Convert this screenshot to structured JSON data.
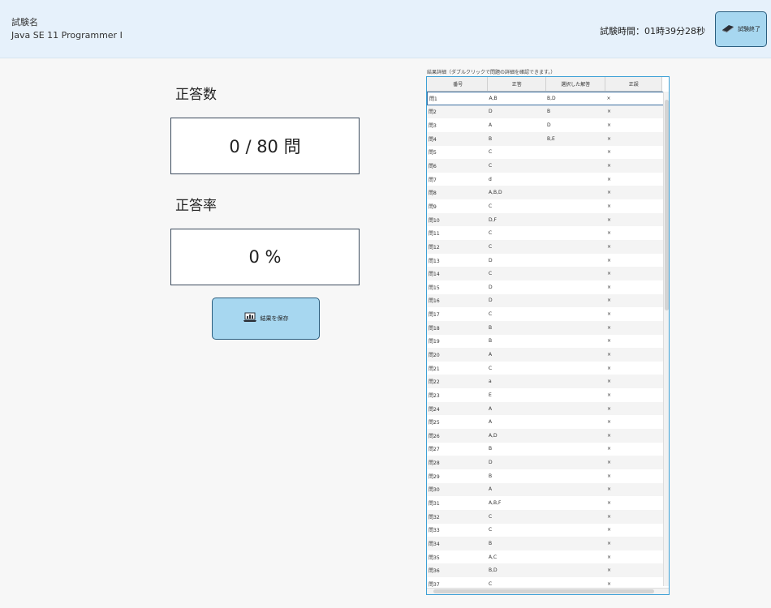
{
  "header": {
    "exam_label": "試験名",
    "exam_name": "Java SE 11 Programmer Ⅰ",
    "timer": "試験時間：01時39分28秒",
    "end_button_label": "試験終了",
    "end_button_icon": "book-icon"
  },
  "score": {
    "correct_title": "正答数",
    "correct_value": "0 / 80 問",
    "rate_title": "正答率",
    "rate_value": "0 %"
  },
  "save_button": {
    "label": "結果を保存",
    "icon": "laptop-chart-icon"
  },
  "results_table": {
    "caption": "結果詳細（ダブルクリックで問題の詳細を確認できます。）",
    "columns": [
      "番号",
      "正答",
      "選択した解答",
      "正誤"
    ],
    "rows": [
      [
        "問1",
        "A,B",
        "B,D",
        "×"
      ],
      [
        "問2",
        "D",
        "B",
        "×"
      ],
      [
        "問3",
        "A",
        "D",
        "×"
      ],
      [
        "問4",
        "B",
        "B,E",
        "×"
      ],
      [
        "問5",
        "C",
        "",
        "×"
      ],
      [
        "問6",
        "C",
        "",
        "×"
      ],
      [
        "問7",
        "d",
        "",
        "×"
      ],
      [
        "問8",
        "A,B,D",
        "",
        "×"
      ],
      [
        "問9",
        "C",
        "",
        "×"
      ],
      [
        "問10",
        "D,F",
        "",
        "×"
      ],
      [
        "問11",
        "C",
        "",
        "×"
      ],
      [
        "問12",
        "C",
        "",
        "×"
      ],
      [
        "問13",
        "D",
        "",
        "×"
      ],
      [
        "問14",
        "C",
        "",
        "×"
      ],
      [
        "問15",
        "D",
        "",
        "×"
      ],
      [
        "問16",
        "D",
        "",
        "×"
      ],
      [
        "問17",
        "C",
        "",
        "×"
      ],
      [
        "問18",
        "B",
        "",
        "×"
      ],
      [
        "問19",
        "B",
        "",
        "×"
      ],
      [
        "問20",
        "A",
        "",
        "×"
      ],
      [
        "問21",
        "C",
        "",
        "×"
      ],
      [
        "問22",
        "a",
        "",
        "×"
      ],
      [
        "問23",
        "E",
        "",
        "×"
      ],
      [
        "問24",
        "A",
        "",
        "×"
      ],
      [
        "問25",
        "A",
        "",
        "×"
      ],
      [
        "問26",
        "A,D",
        "",
        "×"
      ],
      [
        "問27",
        "B",
        "",
        "×"
      ],
      [
        "問28",
        "D",
        "",
        "×"
      ],
      [
        "問29",
        "B",
        "",
        "×"
      ],
      [
        "問30",
        "A",
        "",
        "×"
      ],
      [
        "問31",
        "A,B,F",
        "",
        "×"
      ],
      [
        "問32",
        "C",
        "",
        "×"
      ],
      [
        "問33",
        "C",
        "",
        "×"
      ],
      [
        "問34",
        "B",
        "",
        "×"
      ],
      [
        "問35",
        "A,C",
        "",
        "×"
      ],
      [
        "問36",
        "B,D",
        "",
        "×"
      ],
      [
        "問37",
        "C",
        "",
        "×"
      ]
    ]
  },
  "colors": {
    "header_bg": "#e6f1fb",
    "button_bg": "#a7d7f0",
    "table_border": "#3da0d6"
  }
}
